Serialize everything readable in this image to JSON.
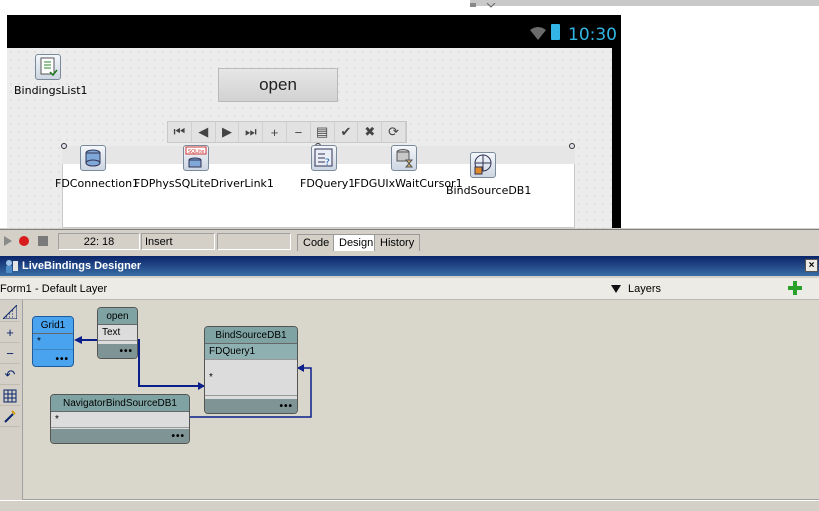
{
  "form": {
    "status_time": "10:30",
    "open_button": "open",
    "navigator_buttons": [
      "⏮",
      "◀",
      "▶",
      "⏭",
      "+",
      "−",
      "▤",
      "✔",
      "✖",
      "⟳"
    ],
    "components": [
      {
        "name": "BindingsList1"
      },
      {
        "name": "FDConnection1"
      },
      {
        "name": "FDPhysSQLiteDriverLink1"
      },
      {
        "name": "FDQuery1"
      },
      {
        "name": "FDGUIxWaitCursor1"
      },
      {
        "name": "BindSourceDB1"
      }
    ],
    "sqlite_badge": "SQLite"
  },
  "ide": {
    "cursor_pos": "22:  18",
    "mode": "Insert",
    "tabs": [
      "Code",
      "Design",
      "History"
    ],
    "active_tab": "Design"
  },
  "livebindings": {
    "title": "LiveBindings Designer",
    "form_label": "Form1",
    "layer_label": " - Default Layer",
    "layers_label": "Layers",
    "nodes": {
      "grid": {
        "title": "Grid1",
        "row": "*",
        "dots": "•••"
      },
      "open": {
        "title": "open",
        "row": "Text",
        "dots": "•••"
      },
      "bindsource": {
        "title": "BindSourceDB1",
        "row1": "FDQuery1",
        "row2": "*",
        "dots": "•••"
      },
      "navigator": {
        "title": "NavigatorBindSourceDB1",
        "row": "*",
        "dots": "•••"
      }
    },
    "colors": {
      "grid_node": "#4aa3ef",
      "bindsource_header": "#7fa3a3",
      "link_line": "#0a1f8a"
    }
  }
}
